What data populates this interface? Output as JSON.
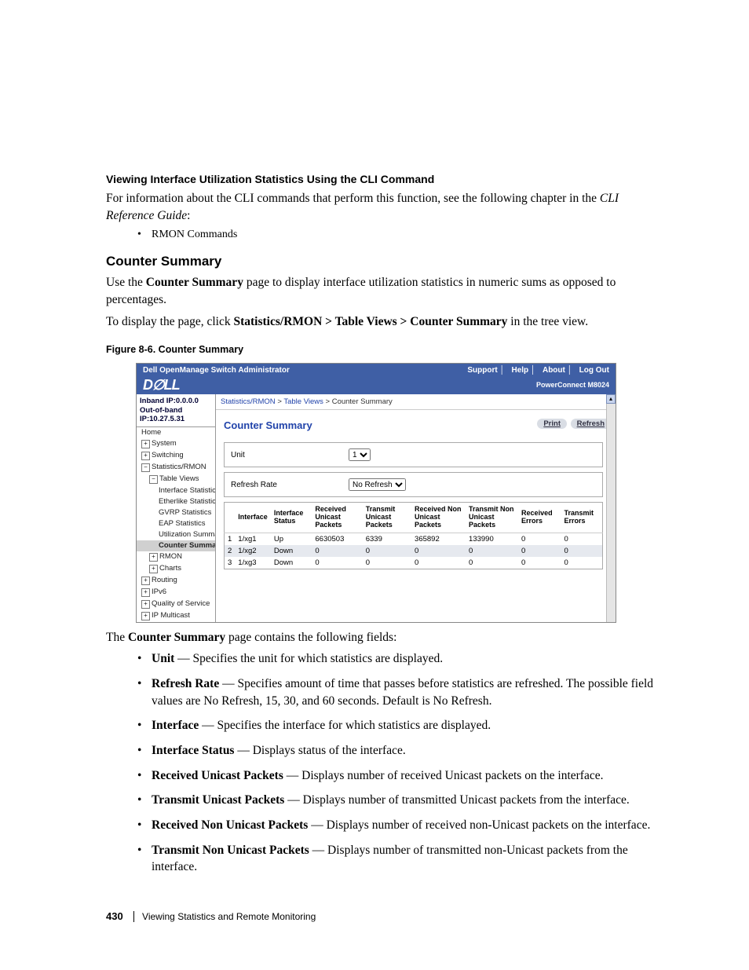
{
  "doc": {
    "h1": "Viewing Interface Utilization Statistics Using the CLI Command",
    "p1a": "For information about the CLI commands that perform this function, see the following chapter in the ",
    "p1b": "CLI Reference Guide",
    "p1c": ":",
    "bullet1": "RMON Commands",
    "h2": "Counter Summary",
    "p2a": "Use the ",
    "p2b": "Counter Summary",
    "p2c": " page to display interface utilization statistics in numeric sums as opposed to percentages.",
    "p3a": "To display the page, click ",
    "p3b": "Statistics/RMON > Table Views > Counter Summary",
    "p3c": " in the tree view.",
    "figcap": "Figure 8-6.    Counter Summary",
    "after_fig": "The ",
    "after_fig_b": "Counter Summary",
    "after_fig_c": " page contains the following fields:",
    "fields": [
      {
        "name": "Unit",
        "desc": " — Specifies the unit for which statistics are displayed."
      },
      {
        "name": "Refresh Rate",
        "desc": " — Specifies amount of time that passes before statistics are refreshed. The possible field values are No Refresh, 15, 30, and 60 seconds. Default is No Refresh."
      },
      {
        "name": "Interface",
        "desc": " — Specifies the interface for which statistics are displayed."
      },
      {
        "name": "Interface Status",
        "desc": " — Displays status of the interface."
      },
      {
        "name": "Received Unicast Packets",
        "desc": " — Displays number of received Unicast packets on the interface."
      },
      {
        "name": "Transmit Unicast Packets",
        "desc": " — Displays number of transmitted Unicast packets from the interface."
      },
      {
        "name": "Received Non Unicast Packets",
        "desc": " — Displays number of received non-Unicast packets on the interface."
      },
      {
        "name": "Transmit Non Unicast Packets",
        "desc": " — Displays number of transmitted non-Unicast packets from the interface."
      }
    ],
    "footer_pn": "430",
    "footer_title": "Viewing Statistics and Remote Monitoring"
  },
  "app": {
    "title": "Dell OpenManage Switch Administrator",
    "links": {
      "support": "Support",
      "help": "Help",
      "about": "About",
      "logout": "Log Out"
    },
    "logo": "D∅LL",
    "product": "PowerConnect M8024",
    "ip1": "Inband IP:0.0.0.0",
    "ip2": "Out-of-band IP:10.27.5.31",
    "tree": {
      "home": "Home",
      "system": "System",
      "switching": "Switching",
      "stat": "Statistics/RMON",
      "tableviews": "Table Views",
      "ifstat": "Interface Statistics",
      "ether": "Etherlike Statistics",
      "gvrp": "GVRP Statistics",
      "eap": "EAP Statistics",
      "util": "Utilization Summary",
      "cs": "Counter Summary",
      "rmon": "RMON",
      "charts": "Charts",
      "routing": "Routing",
      "ipv6": "IPv6",
      "qos": "Quality of Service",
      "ipm": "IP Multicast"
    },
    "bc": {
      "a": "Statistics/RMON",
      "b": "Table Views",
      "c": "Counter Summary"
    },
    "pagetitle": "Counter Summary",
    "print": "Print",
    "refresh": "Refresh",
    "unit_label": "Unit",
    "unit_value": "1",
    "rate_label": "Refresh Rate",
    "rate_value": "No Refresh",
    "thead": {
      "iface": "Interface",
      "status": "Interface Status",
      "rup": "Received Unicast Packets",
      "tup": "Transmit Unicast Packets",
      "rnup": "Received Non Unicast Packets",
      "tnup": "Transmit Non Unicast Packets",
      "rerr": "Received Errors",
      "terr": "Transmit Errors"
    },
    "rows": [
      {
        "n": "1",
        "if": "1/xg1",
        "st": "Up",
        "rup": "6630503",
        "tup": "6339",
        "rnup": "365892",
        "tnup": "133990",
        "rerr": "0",
        "terr": "0"
      },
      {
        "n": "2",
        "if": "1/xg2",
        "st": "Down",
        "rup": "0",
        "tup": "0",
        "rnup": "0",
        "tnup": "0",
        "rerr": "0",
        "terr": "0"
      },
      {
        "n": "3",
        "if": "1/xg3",
        "st": "Down",
        "rup": "0",
        "tup": "0",
        "rnup": "0",
        "tnup": "0",
        "rerr": "0",
        "terr": "0"
      }
    ]
  }
}
